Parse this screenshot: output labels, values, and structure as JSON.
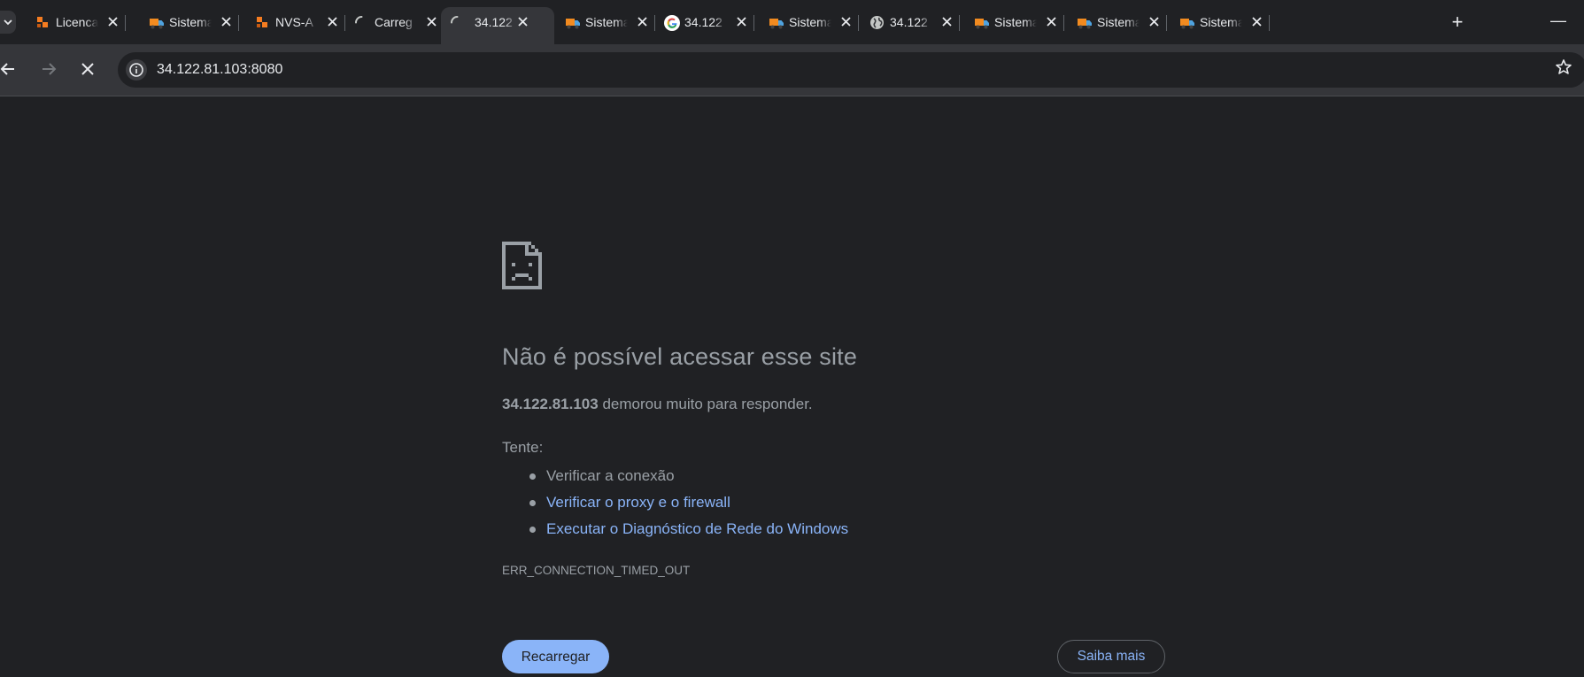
{
  "tabs": [
    {
      "title": "Licenca",
      "favicon": "orange-logo-icon",
      "active": false,
      "loading": false
    },
    {
      "title": "Sistema",
      "favicon": "truck-icon",
      "active": false,
      "loading": false
    },
    {
      "title": "NVS-A",
      "favicon": "orange-logo-icon",
      "active": false,
      "loading": false
    },
    {
      "title": "Carreg",
      "favicon": "loading-spinner-icon",
      "active": false,
      "loading": true
    },
    {
      "title": "34.122",
      "favicon": "loading-spinner-icon",
      "active": true,
      "loading": true
    },
    {
      "title": "Sistema",
      "favicon": "truck-icon",
      "active": false,
      "loading": false
    },
    {
      "title": "34.122",
      "favicon": "google-icon",
      "active": false,
      "loading": false
    },
    {
      "title": "Sistema",
      "favicon": "truck-icon",
      "active": false,
      "loading": false
    },
    {
      "title": "34.122",
      "favicon": "globe-icon",
      "active": false,
      "loading": false
    },
    {
      "title": "Sistema",
      "favicon": "truck-icon",
      "active": false,
      "loading": false
    },
    {
      "title": "Sistema",
      "favicon": "truck-icon",
      "active": false,
      "loading": false
    },
    {
      "title": "Sistema",
      "favicon": "truck-icon",
      "active": false,
      "loading": false
    }
  ],
  "toolbar": {
    "url": "34.122.81.103:8080"
  },
  "error": {
    "heading": "Não é possível acessar esse site",
    "host": "34.122.81.103",
    "description": " demorou muito para responder.",
    "try_label": "Tente:",
    "suggestions": [
      {
        "text": "Verificar a conexão",
        "is_link": false
      },
      {
        "text": "Verificar o proxy e o firewall",
        "is_link": true
      },
      {
        "text": "Executar o Diagnóstico de Rede do Windows",
        "is_link": true
      }
    ],
    "code": "ERR_CONNECTION_TIMED_OUT",
    "reload_label": "Recarregar",
    "more_label": "Saiba mais"
  },
  "colors": {
    "background": "#202124",
    "toolbar": "#35363a",
    "text": "#9aa0a6",
    "link": "#8ab4f8",
    "button": "#8ab4f8"
  }
}
